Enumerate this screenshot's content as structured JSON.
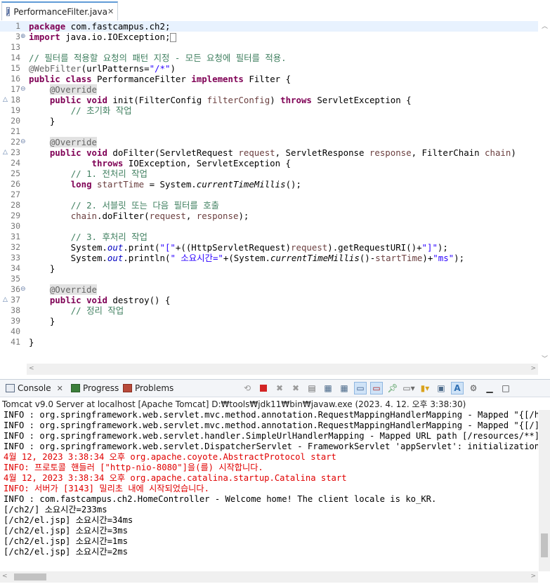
{
  "editor": {
    "tab_title": "PerformanceFilter.java",
    "lines": [
      {
        "n": "1",
        "html": "<span class=\"kw\">package</span> com.fastcampus.ch2;",
        "current": true
      },
      {
        "n": "3",
        "html": "<span class=\"kw\">import</span> java.io.IOException;<span class=\"box\"></span>",
        "fold": "+"
      },
      {
        "n": "13",
        "html": ""
      },
      {
        "n": "14",
        "html": "<span class=\"cm\">// 필터를 적용할 요청의 패턴 지정 - 모든 요청에 필터를 적용.</span>"
      },
      {
        "n": "15",
        "html": "<span class=\"an2\">@WebFilter</span>(urlPatterns=<span class=\"st\">\"/*\"</span>)"
      },
      {
        "n": "16",
        "html": "<span class=\"kw\">public</span> <span class=\"kw\">class</span> PerformanceFilter <span class=\"kw\">implements</span> Filter {"
      },
      {
        "n": "17",
        "html": "    <span class=\"an\">@Override</span>",
        "fold": "⊖"
      },
      {
        "n": "18",
        "html": "    <span class=\"kw\">public</span> <span class=\"kw\">void</span> init(FilterConfig <span class=\"pr\">filterConfig</span>) <span class=\"kw\">throws</span> ServletException {",
        "mark": "△"
      },
      {
        "n": "19",
        "html": "        <span class=\"cm\">// 초기화 작업</span>"
      },
      {
        "n": "20",
        "html": "    }"
      },
      {
        "n": "21",
        "html": ""
      },
      {
        "n": "22",
        "html": "    <span class=\"an\">@Override</span>",
        "fold": "⊖"
      },
      {
        "n": "23",
        "html": "    <span class=\"kw\">public</span> <span class=\"kw\">void</span> doFilter(ServletRequest <span class=\"pr\">request</span>, ServletResponse <span class=\"pr\">response</span>, FilterChain <span class=\"pr\">chain</span>)",
        "mark": "△"
      },
      {
        "n": "24",
        "html": "            <span class=\"kw\">throws</span> IOException, ServletException {"
      },
      {
        "n": "25",
        "html": "        <span class=\"cm\">// 1. 전처리 작업</span>"
      },
      {
        "n": "26",
        "html": "        <span class=\"kw\">long</span> <span class=\"pr\">startTime</span> = System.<span class=\"it\">currentTimeMillis</span>();"
      },
      {
        "n": "27",
        "html": ""
      },
      {
        "n": "28",
        "html": "        <span class=\"cm\">// 2. 서블릿 또는 다음 필터를 호출</span>"
      },
      {
        "n": "29",
        "html": "        <span class=\"pr\">chain</span>.doFilter(<span class=\"pr\">request</span>, <span class=\"pr\">response</span>);"
      },
      {
        "n": "30",
        "html": ""
      },
      {
        "n": "31",
        "html": "        <span class=\"cm\">// 3. 후처리 작업</span>"
      },
      {
        "n": "32",
        "html": "        System.<span class=\"fd\">out</span>.print(<span class=\"st\">\"[\"</span>+((HttpServletRequest)<span class=\"pr\">request</span>).getRequestURI()+<span class=\"st\">\"]\"</span>);"
      },
      {
        "n": "33",
        "html": "        System.<span class=\"fd\">out</span>.println(<span class=\"st\">\" 소요시간=\"</span>+(System.<span class=\"it\">currentTimeMillis</span>()-<span class=\"pr\">startTime</span>)+<span class=\"st\">\"ms\"</span>);"
      },
      {
        "n": "34",
        "html": "    }"
      },
      {
        "n": "35",
        "html": ""
      },
      {
        "n": "36",
        "html": "    <span class=\"an\">@Override</span>",
        "fold": "⊖"
      },
      {
        "n": "37",
        "html": "    <span class=\"kw\">public</span> <span class=\"kw\">void</span> destroy() {",
        "mark": "△"
      },
      {
        "n": "38",
        "html": "        <span class=\"cm\">// 정리 작업</span>"
      },
      {
        "n": "39",
        "html": "    }"
      },
      {
        "n": "40",
        "html": ""
      },
      {
        "n": "41",
        "html": "}"
      }
    ]
  },
  "console": {
    "tabs": [
      {
        "label": "Console",
        "icon": "console-icon"
      },
      {
        "label": "Progress",
        "icon": "progress-icon"
      },
      {
        "label": "Problems",
        "icon": "problems-icon"
      }
    ],
    "caption": "Tomcat v9.0 Server at localhost [Apache Tomcat] D:₩tools₩jdk11₩bin₩javaw.exe  (2023. 4. 12. 오후 3:38:30)",
    "toolbar_icons": [
      "terminate-relaunch-icon",
      "terminate-icon",
      "remove-launch-icon",
      "remove-all-terminated-icon",
      "clear-console-icon",
      "scroll-lock-icon",
      "word-wrap-icon",
      "show-on-stdout-icon",
      "show-on-stderr-icon",
      "pin-console-icon",
      "display-selected-console-icon",
      "open-console-icon",
      "new-console-icon",
      "copy-icon",
      "font-style-icon",
      "settings-icon"
    ],
    "lines": [
      {
        "text": "INFO : org.springframework.web.servlet.mvc.method.annotation.RequestMappingHandlerMapping - Mapped \"{[/hello]",
        "color": "black"
      },
      {
        "text": "INFO : org.springframework.web.servlet.mvc.method.annotation.RequestMappingHandlerMapping - Mapped \"{[/],meth",
        "color": "black"
      },
      {
        "text": "INFO : org.springframework.web.servlet.handler.SimpleUrlHandlerMapping - Mapped URL path [/resources/**] onto",
        "color": "black"
      },
      {
        "text": "INFO : org.springframework.web.servlet.DispatcherServlet - FrameworkServlet 'appServlet': initialization comp",
        "color": "black"
      },
      {
        "text": "4월 12, 2023 3:38:34 오후 org.apache.coyote.AbstractProtocol start",
        "color": "red"
      },
      {
        "text": "INFO: 프로토콜 핸들러 [\"http-nio-8080\"]을(를) 시작합니다.",
        "color": "red"
      },
      {
        "text": "4월 12, 2023 3:38:34 오후 org.apache.catalina.startup.Catalina start",
        "color": "red"
      },
      {
        "text": "INFO: 서버가 [3143] 밀리초 내에 시작되었습니다.",
        "color": "red"
      },
      {
        "text": "INFO : com.fastcampus.ch2.HomeController - Welcome home! The client locale is ko_KR.",
        "color": "black"
      },
      {
        "text": "[/ch2/] 소요시간=233ms",
        "color": "black"
      },
      {
        "text": "[/ch2/el.jsp] 소요시간=34ms",
        "color": "black"
      },
      {
        "text": "[/ch2/el.jsp] 소요시간=3ms",
        "color": "black"
      },
      {
        "text": "[/ch2/el.jsp] 소요시간=1ms",
        "color": "black"
      },
      {
        "text": "[/ch2/el.jsp] 소요시간=2ms",
        "color": "black"
      }
    ]
  },
  "colors": {
    "error_red": "#e00000",
    "current_line": "#e8f2fe",
    "keyword": "#7f0055",
    "comment": "#3f7f5f",
    "string": "#2a00ff"
  }
}
